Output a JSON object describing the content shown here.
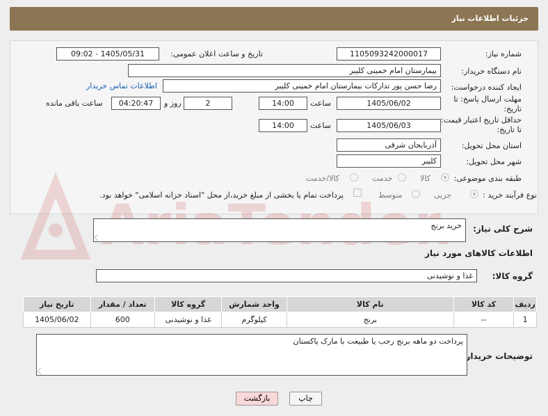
{
  "header": {
    "title": "جزئیات اطلاعات نیاز"
  },
  "form": {
    "need_number": {
      "label": "شماره نیاز:",
      "value": "1105093242000017"
    },
    "announce": {
      "label": "تاریخ و ساعت اعلان عمومی:",
      "value": "1405/05/31 - 09:02"
    },
    "buyer_org": {
      "label": "نام دستگاه خریدار:",
      "value": "بیمارستان امام خمینی کلیبر"
    },
    "creator": {
      "label": "ایجاد کننده درخواست:",
      "value": "رضا حسن پور تدارکات بیمارستان امام خمینی کلیبر",
      "link": "اطلاعات تماس خریدار"
    },
    "reply_deadline": {
      "label": "مهلت ارسال پاسخ: تا تاریخ:",
      "date": "1405/06/02",
      "time_label": "ساعت",
      "time": "14:00",
      "days": "2",
      "days_label": "روز و",
      "remaining": "04:20:47",
      "remaining_label": "ساعت باقی مانده"
    },
    "price_validity": {
      "label": "حداقل تاریخ اعتبار قیمت: تا تاریخ:",
      "date": "1405/06/03",
      "time_label": "ساعت",
      "time": "14:00"
    },
    "province": {
      "label": "استان محل تحویل:",
      "value": "آذربایجان شرقی"
    },
    "city": {
      "label": "شهر محل تحویل:",
      "value": "کلیبر"
    },
    "category": {
      "label": "طبقه بندی موضوعی:",
      "options": [
        "کالا",
        "خدمت",
        "کالا/خدمت"
      ]
    },
    "process": {
      "label": "نوع فرآیند خرید :",
      "options": [
        "جزیی",
        "متوسط"
      ],
      "note": "پرداخت تمام یا بخشی از مبلغ خرید،از محل \"اسناد خزانه اسلامی\" خواهد بود."
    }
  },
  "summary": {
    "label": "شرح کلی نیاز:",
    "value": "خرید برنج"
  },
  "goods_info": {
    "title": "اطلاعات کالاهای مورد نیاز"
  },
  "goods_group": {
    "label": "گروه کالا:",
    "value": "غذا و نوشیدنی"
  },
  "table": {
    "headers": [
      "ردیف",
      "کد کالا",
      "نام کالا",
      "واحد شمارش",
      "گروه کالا",
      "تعداد / مقدار",
      "تاریخ نیاز"
    ],
    "rows": [
      [
        "1",
        "--",
        "برنج",
        "کیلوگرم",
        "غذا و نوشیدنی",
        "600",
        "1405/06/02"
      ]
    ]
  },
  "buyer_notes": {
    "label": "توضیحات خریدار:",
    "value": "پرداخت دو ماهه برنج رجب یا طبیعت با مارک پاکستان"
  },
  "buttons": {
    "print": "چاپ",
    "back": "بازگشت"
  },
  "watermark": {
    "text": "AriaTender.neT"
  },
  "colors": {
    "header": "#8c7553",
    "link": "#1a5fb4",
    "back_button": "#f8d8d8"
  }
}
